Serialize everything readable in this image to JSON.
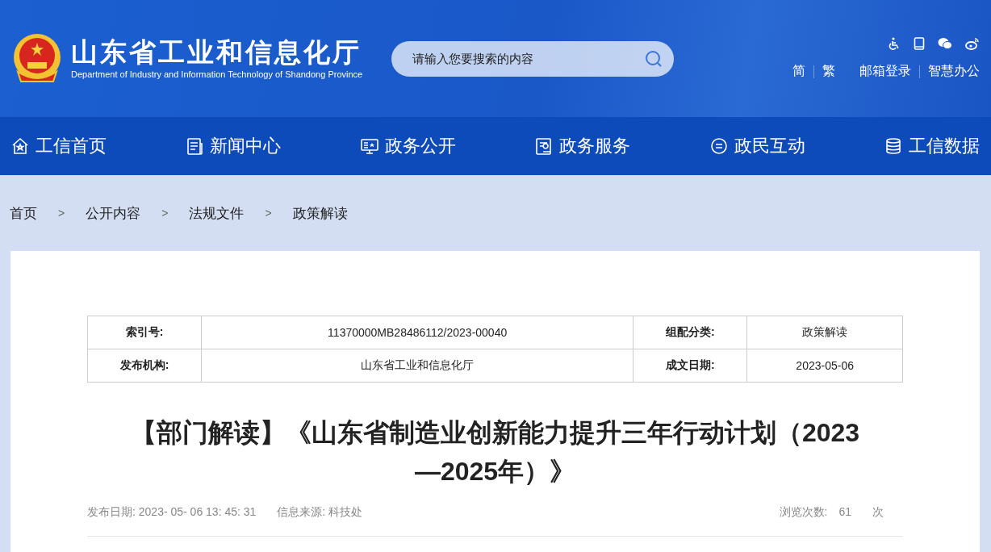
{
  "header": {
    "title": "山东省工业和信息化厅",
    "subtitle": "Department of Industry and Information Technology of Shandong Province",
    "search": {
      "placeholder": "请输入您要搜索的内容"
    },
    "links": [
      "简",
      "繁",
      "邮箱登录",
      "智慧办公"
    ]
  },
  "nav": [
    {
      "label": "工信首页"
    },
    {
      "label": "新闻中心"
    },
    {
      "label": "政务公开"
    },
    {
      "label": "政务服务"
    },
    {
      "label": "政民互动"
    },
    {
      "label": "工信数据"
    }
  ],
  "breadcrumb": [
    "首页",
    "公开内容",
    "法规文件",
    "政策解读"
  ],
  "breadcrumb_separator": ">",
  "meta_table": [
    [
      {
        "label": "索引号:",
        "value": "11370000MB28486112/2023-00040"
      },
      {
        "label": "组配分类:",
        "value": "政策解读"
      }
    ],
    [
      {
        "label": "发布机构:",
        "value": "山东省工业和信息化厅"
      },
      {
        "label": "成文日期:",
        "value": "2023-05-06"
      }
    ]
  ],
  "article": {
    "title": "【部门解读】《山东省制造业创新能力提升三年行动计划（2023—2025年）》",
    "publish_date": "发布日期: 2023- 05- 06 13: 45: 31",
    "source": "信息来源: 科技处",
    "views_label": "浏览次数:",
    "views": "61",
    "views_unit": "次"
  }
}
